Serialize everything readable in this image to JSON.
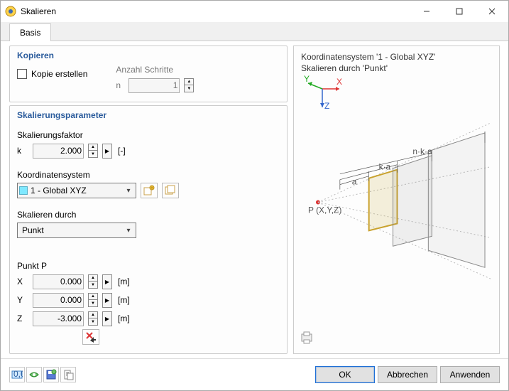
{
  "window": {
    "title": "Skalieren"
  },
  "tabs": {
    "basis": "Basis"
  },
  "copy": {
    "legend": "Kopieren",
    "create_copy": "Kopie erstellen",
    "steps_label": "Anzahl Schritte",
    "n_label": "n",
    "n_value": "1"
  },
  "params": {
    "legend": "Skalierungsparameter",
    "scalefactor_label": "Skalierungsfaktor",
    "k_label": "k",
    "k_value": "2.000",
    "k_unit": "[-]",
    "coordsys_label": "Koordinatensystem",
    "coordsys_value": "1 - Global XYZ",
    "scaleby_label": "Skalieren durch",
    "scaleby_value": "Punkt",
    "pointP_label": "Punkt P",
    "x_label": "X",
    "x_value": "0.000",
    "x_unit": "[m]",
    "y_label": "Y",
    "y_value": "0.000",
    "y_unit": "[m]",
    "z_label": "Z",
    "z_value": "-3.000",
    "z_unit": "[m]"
  },
  "preview": {
    "line1": "Koordinatensystem '1 - Global XYZ'",
    "line2": "Skalieren durch 'Punkt'",
    "axis_x": "X",
    "axis_y": "Y",
    "axis_z": "Z",
    "label_P": "P (X,Y,Z)",
    "label_a": "a",
    "label_ka": "k·a",
    "label_nka": "n·k·a"
  },
  "footer": {
    "ok": "OK",
    "cancel": "Abbrechen",
    "apply": "Anwenden"
  }
}
